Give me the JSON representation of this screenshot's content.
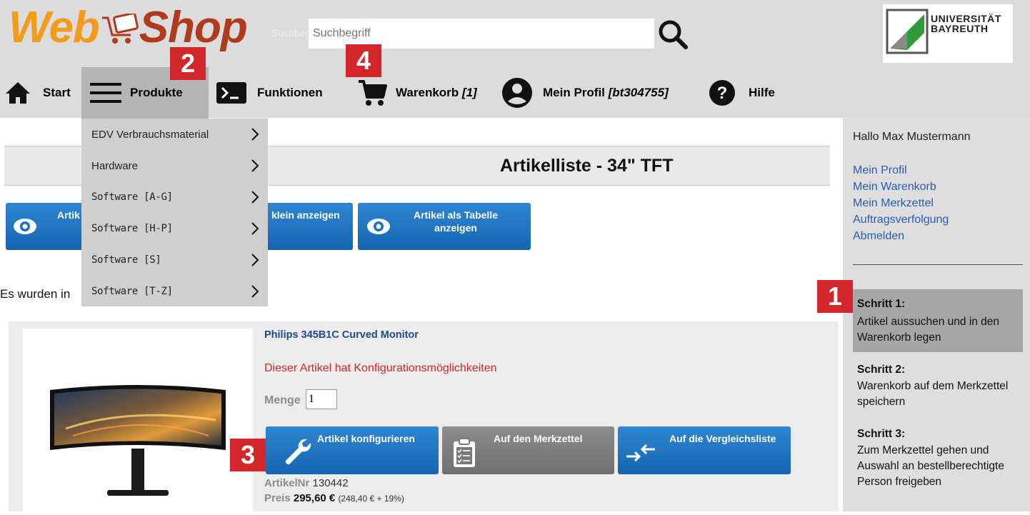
{
  "header": {
    "logo_web": "Web",
    "logo_shop": "Shop",
    "search_hint": "Suchbegriff",
    "search_placeholder": "Suchbegriff",
    "university": "UNIVERSITÄT\nBAYREUTH"
  },
  "nav": {
    "start": "Start",
    "produkte": "Produkte",
    "funktionen": "Funktionen",
    "warenkorb": "Warenkorb",
    "warenkorb_count": "[1]",
    "profil": "Mein Profil",
    "profil_user": "[bt304755]",
    "hilfe": "Hilfe"
  },
  "dropdown": {
    "items": [
      {
        "label": "EDV Verbrauchsmaterial"
      },
      {
        "label": "Hardware"
      },
      {
        "label": "Software [A-G]"
      },
      {
        "label": "Software [H-P]"
      },
      {
        "label": "Software [S]"
      },
      {
        "label": "Software [T-Z]"
      }
    ]
  },
  "main": {
    "page_title": "Artikelliste - 34\" TFT",
    "view_buttons": [
      {
        "label": "Artik"
      },
      {
        "label": "klein anzeigen"
      },
      {
        "label": "Artikel als Tabelle anzeigen"
      }
    ],
    "found_text": "Es wurden in"
  },
  "article": {
    "title": "Philips 345B1C Curved Monitor",
    "config_note": "Dieser Artikel hat Konfigurationsmöglichkeiten",
    "qty_label": "Menge",
    "qty_value": "1",
    "btn_configure": "Artikel konfigurieren",
    "btn_merkzettel": "Auf den Merkzettel",
    "btn_vergleich": "Auf die Vergleichsliste",
    "artnr_label": "ArtikelNr",
    "artnr_value": "130442",
    "preis_label": "Preis",
    "preis_value": "295,60 €",
    "preis_net": "(248,40 € + 19%)"
  },
  "sidebar": {
    "greeting": "Hallo Max Mustermann",
    "links": [
      {
        "label": "Mein Profil"
      },
      {
        "label": "Mein Warenkorb"
      },
      {
        "label": "Mein Merkzettel"
      },
      {
        "label": "Auftragsverfolgung"
      },
      {
        "label": "Abmelden"
      }
    ],
    "steps": [
      {
        "title": "Schritt 1:",
        "text": "Artikel aussuchen und in den Warenkorb legen"
      },
      {
        "title": "Schritt 2:",
        "text": "Warenkorb auf dem Merkzettel speichern"
      },
      {
        "title": "Schritt 3:",
        "text": "Zum Merkzettel gehen und Auswahl an bestellberechtigte Person freigeben"
      }
    ]
  },
  "badges": [
    "1",
    "2",
    "3",
    "4"
  ],
  "colors": {
    "accent_blue": "#1a72c0",
    "badge_red": "#d3262c",
    "logo_orange": "#f39b1a",
    "logo_red": "#b03a1e",
    "link_blue": "#2a5db0",
    "note_red": "#d42626"
  }
}
